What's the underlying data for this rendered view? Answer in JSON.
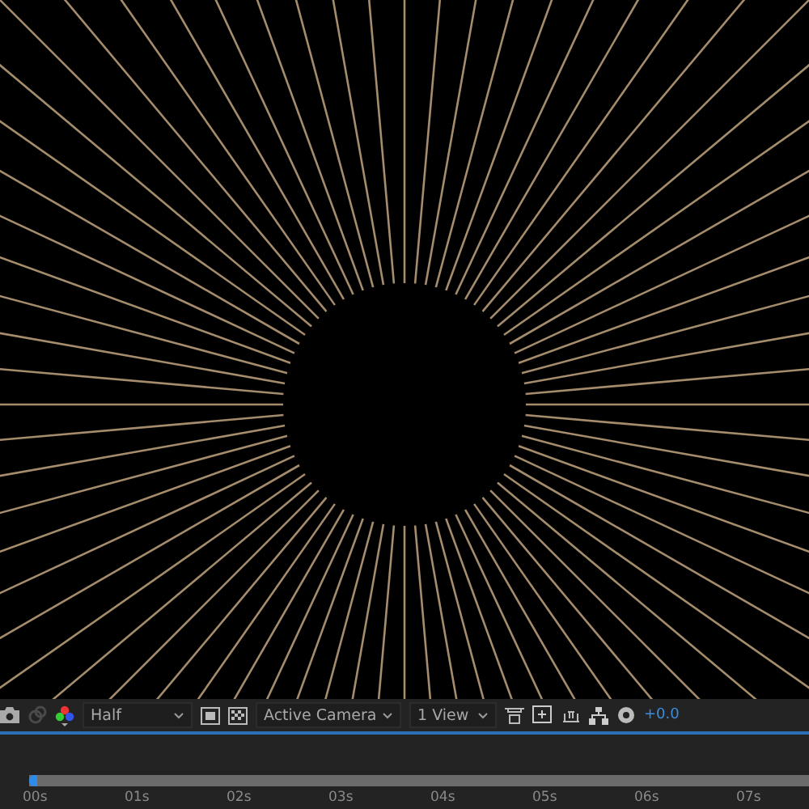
{
  "toolbar": {
    "resolution": "Half",
    "camera": "Active Camera",
    "views": "1 View",
    "exposure": "+0.0"
  },
  "timeline": {
    "ruler": [
      "00s",
      "01s",
      "02s",
      "03s",
      "04s",
      "05s",
      "06s",
      "07s"
    ]
  }
}
